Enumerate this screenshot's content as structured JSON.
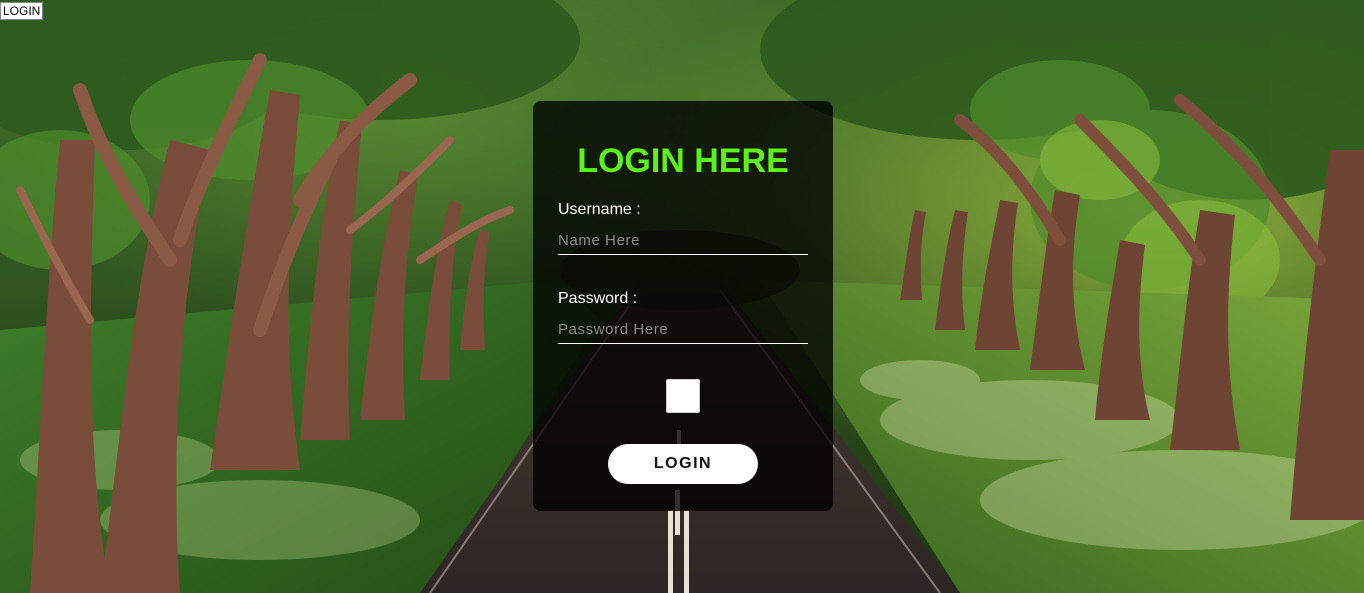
{
  "page": {
    "tab_label": "LOGIN"
  },
  "login": {
    "title": "LOGIN HERE",
    "title_color": "#5cf21a",
    "username_label": "Username :",
    "username_placeholder": "Name Here",
    "username_value": "",
    "password_label": "Password :",
    "password_placeholder": "Password Here",
    "password_value": "",
    "remember_checked": false,
    "button_label": "LOGIN"
  },
  "background": {
    "description_icon": "forest-road-image"
  }
}
